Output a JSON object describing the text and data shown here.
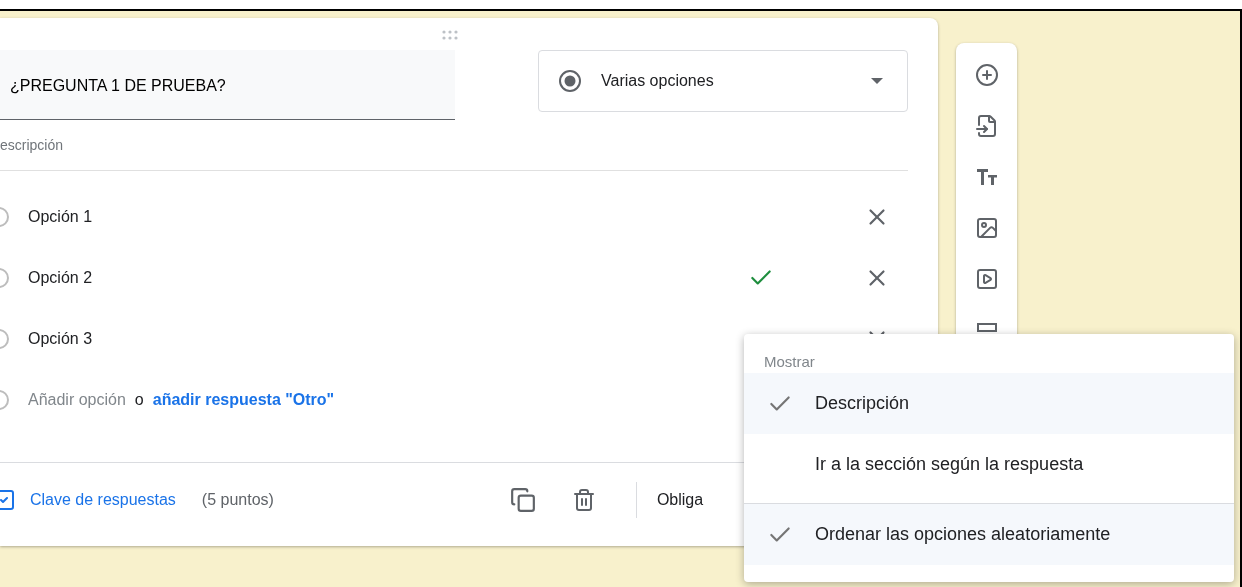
{
  "question": {
    "title": "¿PREGUNTA 1 DE PRUEBA?",
    "description_placeholder": "escripción",
    "type_dropdown": {
      "label": "Varias opciones"
    }
  },
  "options": [
    {
      "label": "Opción 1",
      "correct": false,
      "selected": false
    },
    {
      "label": "Opción 2",
      "correct": true,
      "selected": false
    },
    {
      "label": "Opción 3",
      "correct": false,
      "selected": false
    }
  ],
  "add_option": {
    "selected": false,
    "label": "Añadir opción",
    "separator": "o",
    "link": "añadir respuesta \"Otro\""
  },
  "footer": {
    "answer_key": "Clave de respuestas",
    "points": "(5 puntos)",
    "required_label": "Obliga"
  },
  "menu": {
    "header": "Mostrar",
    "items": [
      {
        "label": "Descripción",
        "checked": true,
        "divider_before": false
      },
      {
        "label": "Ir a la sección según la respuesta",
        "checked": false,
        "divider_before": false
      },
      {
        "label": "Ordenar las opciones aleatoriamente",
        "checked": true,
        "divider_before": true
      }
    ]
  }
}
